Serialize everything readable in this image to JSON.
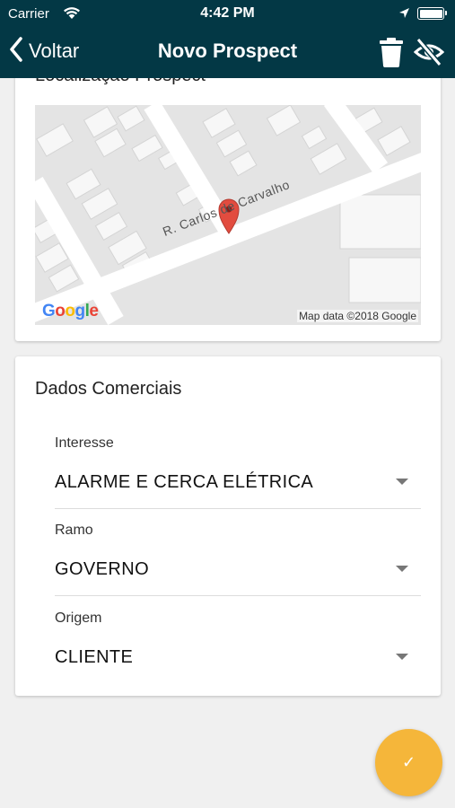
{
  "status": {
    "carrier": "Carrier",
    "time": "4:42 PM"
  },
  "nav": {
    "back_label": "Voltar",
    "title": "Novo Prospect"
  },
  "location_card": {
    "title": "Localização Prospect",
    "street_label": "R. Carlos de Carvalho",
    "attribution": "Map data ©2018 Google",
    "logo_text": "Google"
  },
  "commercial_card": {
    "title": "Dados Comerciais",
    "fields": [
      {
        "label": "Interesse",
        "value": "ALARME E CERCA ELÉTRICA"
      },
      {
        "label": "Ramo",
        "value": "GOVERNO"
      },
      {
        "label": "Origem",
        "value": "CLIENTE"
      }
    ]
  },
  "fab": {
    "icon": "checkmark-icon",
    "glyph": "✓"
  },
  "colors": {
    "header": "#033845",
    "fab": "#f5b63a",
    "marker": "#e24c3f"
  }
}
